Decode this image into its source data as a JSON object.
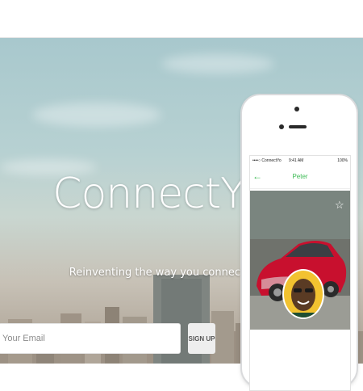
{
  "brand": {
    "title": "ConnectYo",
    "tagline": "Reinventing the way you connect."
  },
  "signup": {
    "email_placeholder": "Your Email",
    "button_label": "SIGN UP"
  },
  "phone": {
    "status_carrier": "••••○ ConnectYo",
    "status_time": "9:41 AM",
    "status_battery": "100%",
    "nav_back_icon": "arrow-left-icon",
    "nav_title": "Peter",
    "favorite_icon": "star-outline-icon"
  },
  "colors": {
    "accent": "#3cba54",
    "avatar_bg": "#f2c230",
    "car_red": "#c8102e"
  }
}
